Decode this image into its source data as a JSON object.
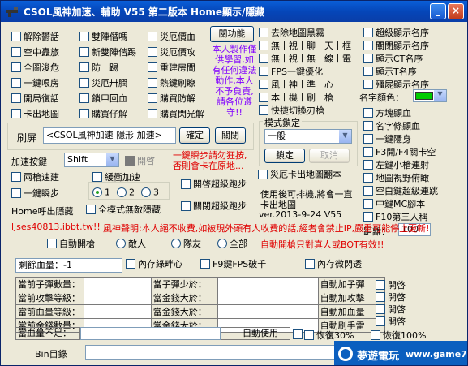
{
  "window": {
    "title": "CSOL風神加速、輔助 V55 第二版本 Home顯示/隱藏",
    "min": "_",
    "close": "×"
  },
  "col1": [
    "解除鬱話",
    "空中矗旅",
    "全圖浚危",
    "一鍵哏房",
    "開局復話",
    "卡出地圖"
  ],
  "col2": [
    "雙陣僭嗎",
    "新雙陣偕踢",
    "防丨踢",
    "災厄卅膶",
    "鎖甲回血",
    "購買仔解"
  ],
  "col3": [
    "災厄價血",
    "災厄價攻",
    "重建房間",
    "熱鍵刷瞭",
    "購買防解",
    "購買閃光解"
  ],
  "kill_button": "關功能",
  "notice": "本人製作僅供學習,如有任何違法動作,本人不予負責,請各位遵守!!",
  "col4": [
    "去除地圖黑霧",
    "無丨視丨聊丨天丨框",
    "無丨視丨無丨線丨電",
    "FPS一鍵優化",
    "風丨神丨準丨心",
    "本丨機丨刷丨槍",
    "快捷切換刃槍"
  ],
  "col5": [
    "超級顯示名序",
    "關閉顯示名序",
    "顯示CT名序",
    "顯示T名序",
    "殭屍顯示名序"
  ],
  "name_color_label": "名字顏色：",
  "col5b": [
    "方塊顯血",
    "名字條顯血",
    "一鍵隱身",
    "F3開/F4關卡空",
    "左鍵小槍連射",
    "地圖視野俯瞰",
    "空白鍵超級連跳",
    "中鍵MC腳本",
    "F10第三人稱"
  ],
  "distance_label": "距離：",
  "distance_value": "100",
  "refresh_label": "刷屏",
  "refresh_value": "<CSOL風神加速 隱形 加速>",
  "confirm": "確定",
  "close_btn": "關閉",
  "mode_group_label": "模式鎖定",
  "mode_value": "一般",
  "lock": "鎖定",
  "cancel": "取消",
  "speed_label": "加速按鍵",
  "speed_value": "Shift",
  "speed_open": "開啓",
  "warning1": "一鍵瞬步請勿狂按,",
  "warning2": "否則會卡在原地...",
  "two_guns": "兩槍速建",
  "slow_speed": "緩衝加速",
  "one_flash": "一鍵瞬步",
  "radio_nums": [
    "1",
    "2",
    "3"
  ],
  "big_jump": "開啓超級跑步",
  "close_jump": "關閉超級跑步",
  "home_label": "Home呼出隱藏",
  "full_hide": "全模式無敵隱藏",
  "stuck": "災厄卡出地圖翻本",
  "usage": "使用後可排機,將會一直卡出地圖",
  "version": "ver.2013-9-24 V55",
  "lj": "ljses40813.ibbt.tw!!",
  "statement": "風神聲明:本人絕不收費,如被現外頭有人收費的話,經者會禁止IP,嚴重可能停止更新!",
  "auto_fire": "自動開槍",
  "enemy": "敵人",
  "team": "隊友",
  "all": "全部",
  "auto_hint": "自動開槍只對真人或BOT有效!!",
  "remain_blood": "剩餘血量：-1",
  "mem_label": "內存綠畔心",
  "fps_label": "F9鍵FPS破千",
  "mem_flash": "內存微閃透",
  "rows": [
    {
      "a": "當前子彈數量：",
      "b": "當子彈少於：",
      "c": "自動加子彈",
      "d": "開啓"
    },
    {
      "a": "當前攻擊等級：",
      "b": "當金錢大於：",
      "c": "自動加攻擊",
      "d": "開啓"
    },
    {
      "a": "當前血量等級：",
      "b": "當金錢大於：",
      "c": "自動加血量",
      "d": "開啓"
    },
    {
      "a": "當前金錢數量：",
      "b": "當金錢大於：",
      "c": "自動刷手雷",
      "d": "開啓"
    }
  ],
  "low_blood": "當血量不足：",
  "auto_use": "自動使用",
  "restore30": "恢復30%",
  "restore100": "恢復100%",
  "bin_label": "Bin目錄",
  "watermark": {
    "cn": "夢遊電玩",
    "url": "www.game735.com"
  },
  "colors": {
    "title": "#0546b9",
    "red": "#e00000",
    "purple": "#8000ff",
    "green": "#00cc00"
  }
}
